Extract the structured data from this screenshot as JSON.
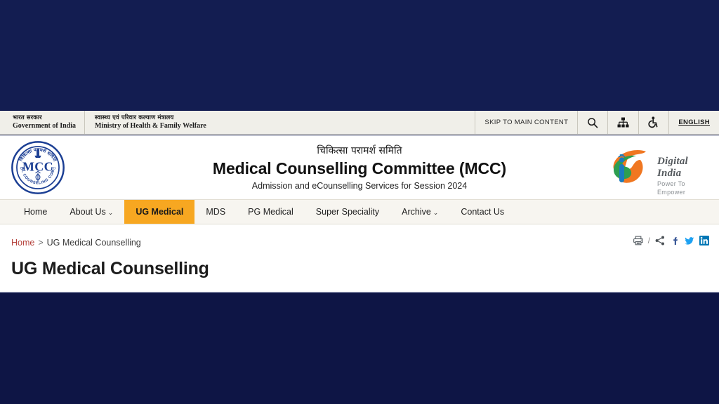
{
  "topbar": {
    "gov_hi": "भारत सरकार",
    "gov_en": "Government of India",
    "ministry_hi": "स्वास्थ्य एवं परिवार कल्याण मंत्रालय",
    "ministry_en": "Ministry of Health & Family Welfare",
    "skip_label": "SKIP TO MAIN CONTENT",
    "search_icon": "search-icon",
    "sitemap_icon": "sitemap-icon",
    "accessibility_icon": "accessibility-icon",
    "language_label": "ENGLISH"
  },
  "masthead": {
    "logo_alt": "MCC logo",
    "logo_text": "MCC",
    "logo_ring_hi": "चिकित्सा परामर्श समिति",
    "logo_ring_en": "MEDICAL COUNSELING COMMITTEE",
    "title_hi": "चिकित्सा परामर्श समिति",
    "title_en": "Medical Counselling Committee (MCC)",
    "subtitle": "Admission and eCounselling Services for Session 2024",
    "digital_india_name": "Digital India",
    "digital_india_tagline": "Power To Empower"
  },
  "nav": {
    "items": [
      {
        "label": "Home",
        "active": false,
        "caret": ""
      },
      {
        "label": "About Us",
        "active": false,
        "caret": "⌄"
      },
      {
        "label": "UG Medical",
        "active": true,
        "caret": ""
      },
      {
        "label": "MDS",
        "active": false,
        "caret": ""
      },
      {
        "label": "PG Medical",
        "active": false,
        "caret": ""
      },
      {
        "label": "Super Speciality",
        "active": false,
        "caret": ""
      },
      {
        "label": "Archive",
        "active": false,
        "caret": "⌄"
      },
      {
        "label": "Contact Us",
        "active": false,
        "caret": ""
      }
    ]
  },
  "content": {
    "breadcrumb_home": "Home",
    "breadcrumb_sep": ">",
    "breadcrumb_current": "UG Medical Counselling",
    "page_title": "UG Medical Counselling",
    "share": {
      "print_icon": "printer-icon",
      "separator": "/",
      "share_icon": "share-icon",
      "facebook_icon": "facebook-icon",
      "twitter_icon": "twitter-icon",
      "linkedin_icon": "linkedin-icon"
    }
  },
  "colors": {
    "navy": "#131d51",
    "strip_bg": "#f0efe9",
    "nav_bg": "#f7f5f0",
    "accent_orange": "#f7a721",
    "breadcrumb_link": "#b5413b",
    "facebook_blue": "#3b5998",
    "twitter_blue": "#1da1f2",
    "linkedin_blue": "#0077b5"
  }
}
